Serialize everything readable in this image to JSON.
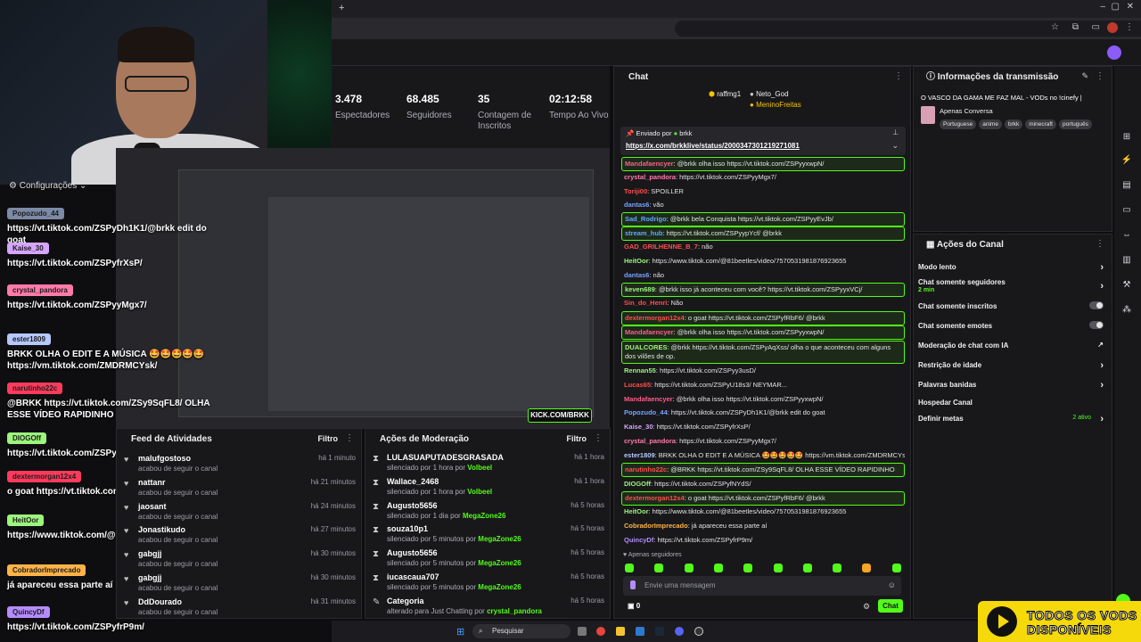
{
  "browser": {
    "avatar_color": "#8b5cf6"
  },
  "overlay": {
    "config_label": "Configurações",
    "messages": [
      {
        "user": "Popozudo_44",
        "color": "#7c8aa5",
        "text": "https://vt.tiktok.com/ZSPyDh1K1/@brkk edit do goat"
      },
      {
        "user": "Kaise_30",
        "color": "#d6a5ff",
        "text": "https://vt.tiktok.com/ZSPyfrXsP/"
      },
      {
        "user": "crystal_pandora",
        "color": "#ff7aa8",
        "text": "https://vt.tiktok.com/ZSPyyMgx7/"
      },
      {
        "user": "ester1809",
        "color": "#b5c8ff",
        "text": "BRKK OLHA O EDIT E A MÚSICA 🤩🤩🤩🤩🤩 https://vm.tiktok.com/ZMDRMCYsk/"
      },
      {
        "user": "narutinho22c",
        "color": "#ff3b5c",
        "text": "@BRKK https://vt.tiktok.com/ZSy9SqFL8/ OLHA ESSE VÍDEO RAPIDINHO"
      },
      {
        "user": "DIOGOff",
        "color": "#9cf57d",
        "text": "https://vt.tiktok.com/ZSPyfNYdS/"
      },
      {
        "user": "dextermorgan12x4",
        "color": "#ff3b5c",
        "text": "o goat https://vt.tiktok.com/ZSPyfRbF6/ @brkk"
      },
      {
        "user": "HeitOor",
        "color": "#9cf57d",
        "text": "https://www.tiktok.com/@81beetles/video/7570531981876923655"
      },
      {
        "user": "CobradorImprecado",
        "color": "#ffb347",
        "text": "já apareceu essa parte aí"
      },
      {
        "user": "QuincyDf",
        "color": "#b58cff",
        "text": "https://vt.tiktok.com/ZSPyfrP9m/"
      }
    ]
  },
  "stats": [
    {
      "value": "3.478",
      "label": "Espectadores"
    },
    {
      "value": "68.485",
      "label": "Seguidores"
    },
    {
      "value": "35",
      "label": "Contagem de Inscritos"
    },
    {
      "value": "02:12:58",
      "label": "Tempo Ao Vivo"
    }
  ],
  "preview": {
    "watermark": "KICK.COM/BRKK"
  },
  "feed": {
    "title": "Feed de Atividades",
    "filter": "Filtro",
    "items": [
      {
        "name": "malufgostoso",
        "action": "acabou de seguir o canal",
        "time": "há 1 minuto"
      },
      {
        "name": "nattanr",
        "action": "acabou de seguir o canal",
        "time": "há 21 minutos"
      },
      {
        "name": "jaosant",
        "action": "acabou de seguir o canal",
        "time": "há 24 minutos"
      },
      {
        "name": "Jonastikudo",
        "action": "acabou de seguir o canal",
        "time": "há 27 minutos"
      },
      {
        "name": "gabgjj",
        "action": "acabou de seguir o canal",
        "time": "há 30 minutos"
      },
      {
        "name": "gabgjj",
        "action": "acabou de seguir o canal",
        "time": "há 30 minutos"
      },
      {
        "name": "DdDourado",
        "action": "acabou de seguir o canal",
        "time": "há 31 minutos"
      }
    ]
  },
  "moderation": {
    "title": "Ações de Moderação",
    "filter": "Filtro",
    "items": [
      {
        "name": "LULASUAPUTADESGRASADA",
        "action": "silenciado por 1 hora por",
        "by": "Volbeel",
        "time": "há 1 hora"
      },
      {
        "name": "Wallace_2468",
        "action": "silenciado por 1 hora por",
        "by": "Volbeel",
        "time": "há 1 hora"
      },
      {
        "name": "Augusto5656",
        "action": "silenciado por 1 dia por",
        "by": "MegaZone26",
        "time": "há 5 horas"
      },
      {
        "name": "souza10p1",
        "action": "silenciado por 5 minutos por",
        "by": "MegaZone26",
        "time": "há 5 horas"
      },
      {
        "name": "Augusto5656",
        "action": "silenciado por 5 minutos por",
        "by": "MegaZone26",
        "time": "há 5 horas"
      },
      {
        "name": "iucascaua707",
        "action": "silenciado por 5 minutos por",
        "by": "MegaZone26",
        "time": "há 5 horas"
      },
      {
        "name": "Categoria",
        "action": "alterado para Just Chatting por",
        "by": "crystal_pandora",
        "time": "há 5 horas"
      }
    ]
  },
  "chat": {
    "title": "Chat",
    "top_users": [
      {
        "name": "raffmg1",
        "count": "1"
      },
      {
        "name": "Neto_God",
        "count": "1"
      },
      {
        "name": "MeninoFreitas",
        "count": "1"
      }
    ],
    "pinned_by_label": "Enviado por",
    "pinned_user": "brkk",
    "pinned_text": "https://x.com/brkklive/status/2000347301219271081",
    "messages": [
      {
        "user": "Mandafaencyer",
        "ucolor": "#ff5b8a",
        "text": ": @brkk olha isso https://vt.tiktok.com/ZSPyyxwpN/",
        "hl": true
      },
      {
        "user": "crystal_pandora",
        "ucolor": "#ff7aa8",
        "text": ": https://vt.tiktok.com/ZSPyyMgx7/",
        "hl": false
      },
      {
        "user": "Toriji00",
        "ucolor": "#ff4d4d",
        "text": ": SPOILLER",
        "hl": false
      },
      {
        "user": "dantas6",
        "ucolor": "#7aa2ff",
        "text": ": vão",
        "hl": false
      },
      {
        "user": "Sad_Rodrigo",
        "ucolor": "#5fa8ff",
        "text": ": @brkk bela Conquista https://vt.tiktok.com/ZSPyyEvJb/",
        "hl": true
      },
      {
        "user": "stream_hub",
        "ucolor": "#5fa8ff",
        "text": ": https://vt.tiktok.com/ZSPyypYcf/ @brkk",
        "hl": true
      },
      {
        "user": "GAD_GRILHENNE_B_7",
        "ucolor": "#ff4d4d",
        "text": ": não",
        "hl": false
      },
      {
        "user": "HeitOor",
        "ucolor": "#9cf57d",
        "text": ": https://www.tiktok.com/@81beetles/video/7570531981876923655",
        "hl": false
      },
      {
        "user": "dantas6",
        "ucolor": "#7aa2ff",
        "text": ": não",
        "hl": false
      },
      {
        "user": "keven689",
        "ucolor": "#9cf57d",
        "text": ": @brkk isso já aconteceu com você? https://vt.tiktok.com/ZSPyyxVCj/",
        "hl": true
      },
      {
        "user": "Sin_do_Henri",
        "ucolor": "#ff4d4d",
        "text": ": Não",
        "hl": false
      },
      {
        "user": "dextermorgan12x4",
        "ucolor": "#ff4d4d",
        "text": ": o goat https://vt.tiktok.com/ZSPyfRbF6/ @brkk",
        "hl": true
      },
      {
        "user": "Mandafaencyer",
        "ucolor": "#ff5b8a",
        "text": ": @brkk olha isso https://vt.tiktok.com/ZSPyyxwpN/",
        "hl": true
      },
      {
        "user": "DUALCORES",
        "ucolor": "#9cf57d",
        "text": ": @brkk https://vt.tiktok.com/ZSPyAqXss/ olha o que aconteceu com alguns dos vilões de op.",
        "hl": true
      },
      {
        "user": "Rennan55",
        "ucolor": "#9cf57d",
        "text": ": https://vt.tiktok.com/ZSPyy3usD/",
        "hl": false
      },
      {
        "user": "Lucas65",
        "ucolor": "#ff4d4d",
        "text": ": https://vt.tiktok.com/ZSPyU18s3/ NEYMAR...",
        "hl": false
      },
      {
        "user": "Mandafaencyer",
        "ucolor": "#ff5b8a",
        "text": ": @brkk olha isso https://vt.tiktok.com/ZSPyyxwpN/",
        "hl": false
      },
      {
        "user": "Popozudo_44",
        "ucolor": "#7aa2ff",
        "text": ": https://vt.tiktok.com/ZSPyDh1K1/@brkk edit do goat",
        "hl": false
      },
      {
        "user": "Kaise_30",
        "ucolor": "#d6a5ff",
        "text": ": https://vt.tiktok.com/ZSPyfrXsP/",
        "hl": false
      },
      {
        "user": "crystal_pandora",
        "ucolor": "#ff7aa8",
        "text": ": https://vt.tiktok.com/ZSPyyMgx7/",
        "hl": false
      },
      {
        "user": "ester1809",
        "ucolor": "#b5c8ff",
        "text": ": BRKK OLHA O EDIT E A MÚSICA 🤩🤩🤩🤩🤩 https://vm.tiktok.com/ZMDRMCYsk/",
        "hl": false
      },
      {
        "user": "narutinho22c",
        "ucolor": "#ff4d4d",
        "text": ": @BRKK https://vt.tiktok.com/ZSy9SqFL8/ OLHA ESSE VÍDEO RAPIDINHO",
        "hl": true
      },
      {
        "user": "DIOGOff",
        "ucolor": "#9cf57d",
        "text": ": https://vt.tiktok.com/ZSPyfNYdS/",
        "hl": false
      },
      {
        "user": "dextermorgan12x4",
        "ucolor": "#ff4d4d",
        "text": ": o goat https://vt.tiktok.com/ZSPyfRbF6/ @brkk",
        "hl": true
      },
      {
        "user": "HeitOor",
        "ucolor": "#9cf57d",
        "text": ": https://www.tiktok.com/@81beetles/video/7570531981876923655",
        "hl": false
      },
      {
        "user": "CobradorImprecado",
        "ucolor": "#ffb347",
        "text": ": já apareceu essa parte aí",
        "hl": false
      },
      {
        "user": "QuincyDf",
        "ucolor": "#b58cff",
        "text": ": https://vt.tiktok.com/ZSPyfrP9m/",
        "hl": false
      }
    ],
    "followers_only": "Apenas seguidores",
    "input_placeholder": "Envie uma mensagem",
    "count": "0",
    "send_label": "Chat"
  },
  "info": {
    "title": "Informações da transmissão",
    "stream_title": "O VASCO DA GAMA ME FAZ MAL - VODs no !cinefy |",
    "category": "Apenas Conversa",
    "tags": [
      "Portuguese",
      "anime",
      "brkk",
      "minecraft",
      "português"
    ]
  },
  "actions": {
    "title": "Ações do Canal",
    "items": [
      {
        "label": "Modo lento",
        "sub": "",
        "kind": "chevron"
      },
      {
        "label": "Chat somente seguidores",
        "sub": "2 min",
        "kind": "chevron"
      },
      {
        "label": "Chat somente inscritos",
        "sub": "",
        "kind": "toggle"
      },
      {
        "label": "Chat somente emotes",
        "sub": "",
        "kind": "toggle"
      },
      {
        "label": "Moderação de chat com IA",
        "sub": "",
        "kind": "external"
      },
      {
        "label": "Restrição de idade",
        "sub": "",
        "kind": "chevron"
      },
      {
        "label": "Palavras banidas",
        "sub": "",
        "kind": "chevron"
      },
      {
        "label": "Hospedar Canal",
        "sub": "",
        "kind": "none"
      },
      {
        "label": "Definir metas",
        "sub": "",
        "kind": "chevron",
        "badge": "2 ativo"
      }
    ]
  },
  "taskbar": {
    "search_label": "Pesquisar"
  },
  "banner": {
    "line1": "TODOS OS VODS",
    "line2": "DISPONÍVEIS"
  },
  "colors": {
    "accent": "#53fc18",
    "banner": "#f5d90a"
  }
}
